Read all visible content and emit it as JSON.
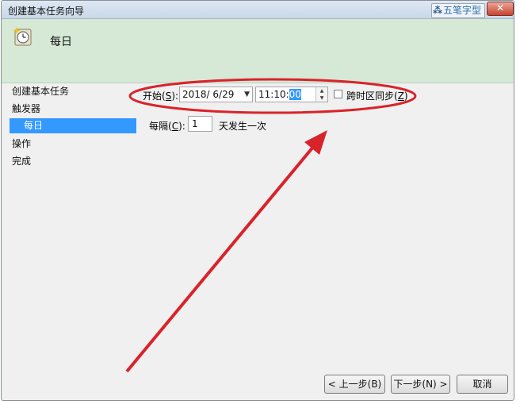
{
  "window": {
    "title": "创建基本任务向导",
    "close": "✕"
  },
  "watermark": {
    "icon": "五笔字型-logo",
    "text": "五笔字型"
  },
  "header": {
    "icon": "clock-icon",
    "title": "每日"
  },
  "sidebar": {
    "items": [
      {
        "label": "创建基本任务"
      },
      {
        "label": "触发器"
      },
      {
        "label": "每日",
        "active": true
      },
      {
        "label": "操作"
      },
      {
        "label": "完成"
      }
    ]
  },
  "form": {
    "start_label_pre": "开始(",
    "start_key": "S",
    "start_label_post": "):",
    "date_value": "2018/  6/29",
    "time_value_main": "11:10:",
    "time_value_sel": "00",
    "sync_label_pre": "跨时区同步(",
    "sync_key": "Z",
    "sync_label_post": ")",
    "every_label_pre": "每隔(",
    "every_key": "C",
    "every_label_post": "):",
    "every_value": "1",
    "every_suffix": "天发生一次"
  },
  "buttons": {
    "back": "< 上一步(B)",
    "next": "下一步(N) >",
    "cancel": "取消"
  },
  "colors": {
    "annotation": "#d9232a",
    "header_bg": "#d6e8d6",
    "selection": "#3399ff"
  }
}
